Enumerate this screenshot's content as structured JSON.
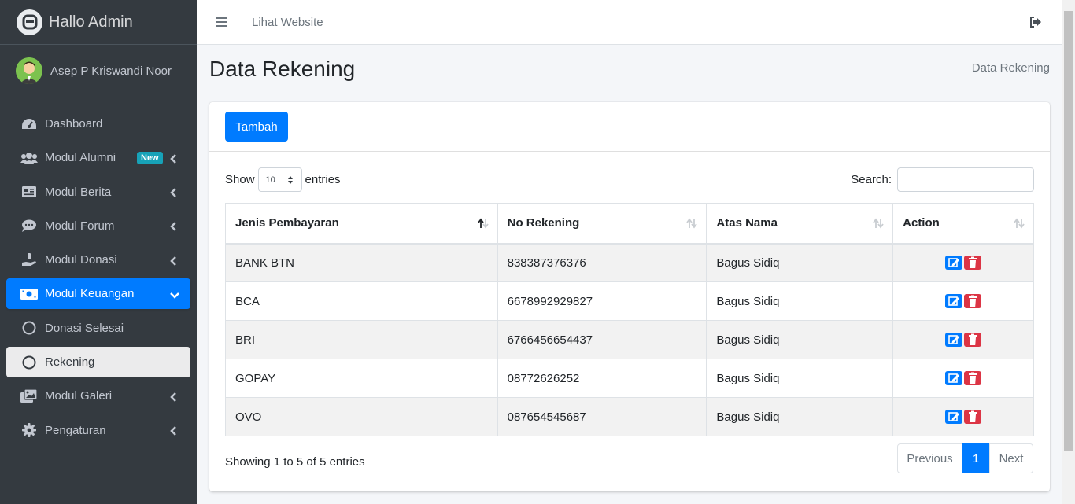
{
  "brand": {
    "title": "Hallo Admin"
  },
  "user": {
    "name": "Asep P Kriswandi Noor"
  },
  "sidebar": {
    "items": [
      {
        "label": "Dashboard"
      },
      {
        "label": "Modul Alumni",
        "badge": "New"
      },
      {
        "label": "Modul Berita"
      },
      {
        "label": "Modul Forum"
      },
      {
        "label": "Modul Donasi"
      },
      {
        "label": "Modul Keuangan"
      },
      {
        "label": "Donasi Selesai"
      },
      {
        "label": "Rekening"
      },
      {
        "label": "Modul Galeri"
      },
      {
        "label": "Pengaturan"
      }
    ]
  },
  "topbar": {
    "link": "Lihat Website"
  },
  "page": {
    "title": "Data Rekening",
    "breadcrumb": "Data Rekening"
  },
  "card": {
    "add_button": "Tambah"
  },
  "table_controls": {
    "show_label": "Show",
    "entries_label": "entries",
    "length_value": "10",
    "search_label": "Search:"
  },
  "table": {
    "columns": [
      "Jenis Pembayaran",
      "No Rekening",
      "Atas Nama",
      "Action"
    ],
    "rows": [
      [
        "BANK BTN",
        "838387376376",
        "Bagus Sidiq"
      ],
      [
        "BCA",
        "6678992929827",
        "Bagus Sidiq"
      ],
      [
        "BRI",
        "6766456654437",
        "Bagus Sidiq"
      ],
      [
        "GOPAY",
        "08772626252",
        "Bagus Sidiq"
      ],
      [
        "OVO",
        "087654545687",
        "Bagus Sidiq"
      ]
    ]
  },
  "footer": {
    "info": "Showing 1 to 5 of 5 entries",
    "prev": "Previous",
    "page": "1",
    "next": "Next"
  },
  "colors": {
    "primary": "#007bff",
    "danger": "#dc3545",
    "sidebar": "#343a40",
    "badge": "#17a2b8"
  }
}
